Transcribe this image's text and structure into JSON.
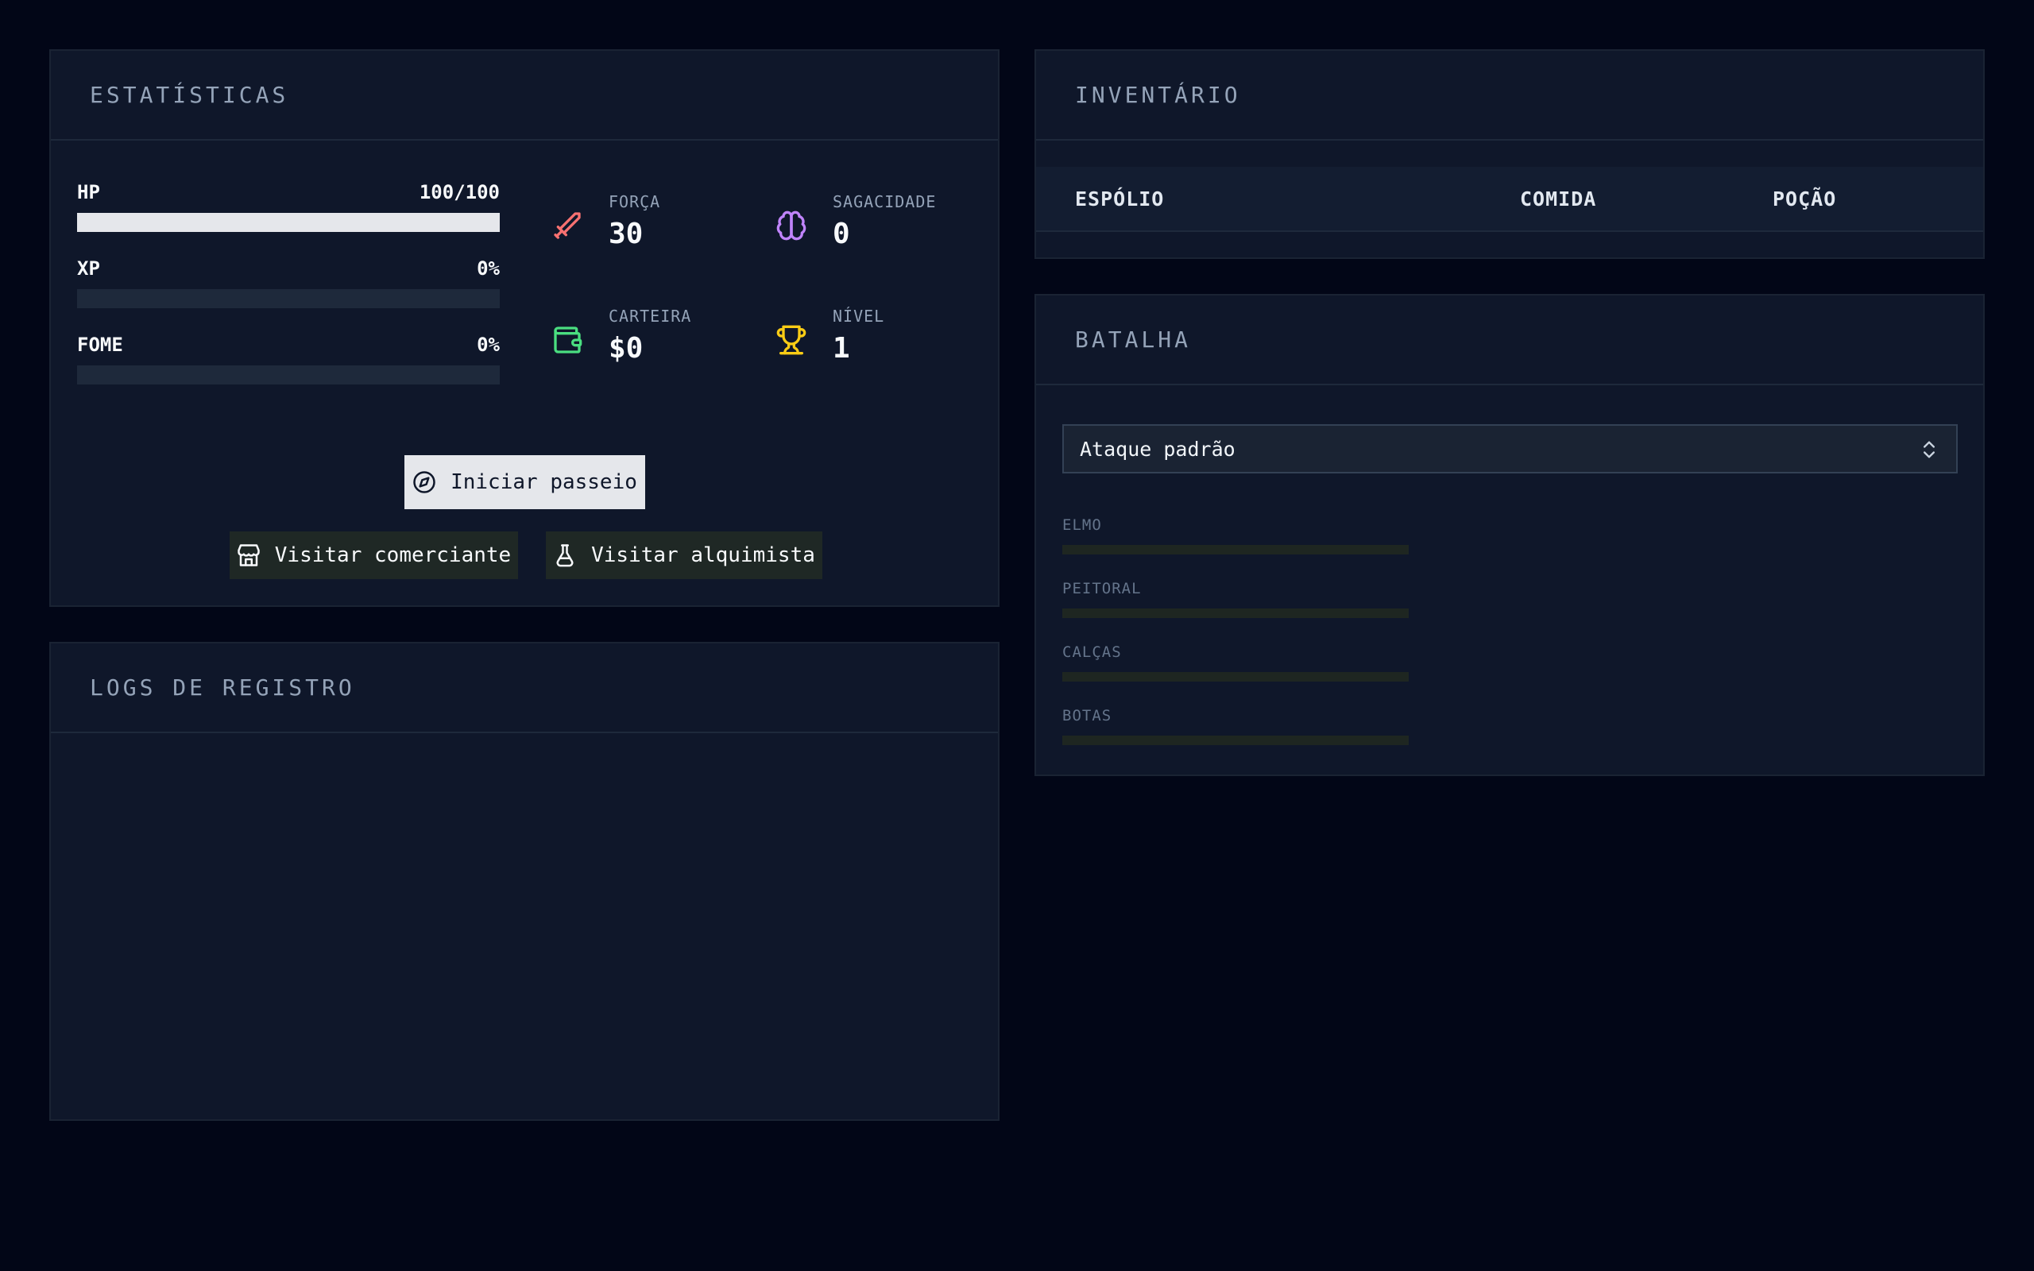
{
  "stats": {
    "title": "ESTATÍSTICAS",
    "bars": [
      {
        "label": "HP",
        "value_text": "100/100",
        "fill": 1.0
      },
      {
        "label": "XP",
        "value_text": "0%",
        "fill": 0.0
      },
      {
        "label": "FOME",
        "value_text": "0%",
        "fill": 0.0
      }
    ],
    "attributes": [
      {
        "label": "FORÇA",
        "value": "30",
        "icon": "sword-icon",
        "color": "#f87171"
      },
      {
        "label": "SAGACIDADE",
        "value": "0",
        "icon": "brain-icon",
        "color": "#c084fc"
      },
      {
        "label": "CARTEIRA",
        "value": "$0",
        "icon": "wallet-icon",
        "color": "#4ade80"
      },
      {
        "label": "NÍVEL",
        "value": "1",
        "icon": "trophy-icon",
        "color": "#facc15"
      }
    ],
    "actions": {
      "start_walk": "Iniciar passeio",
      "visit_merchant": "Visitar comerciante",
      "visit_alchemist": "Visitar alquimista"
    }
  },
  "logs": {
    "title": "LOGS DE REGISTRO"
  },
  "inventory": {
    "title": "INVENTÁRIO",
    "columns": [
      "ESPÓLIO",
      "COMIDA",
      "POÇÃO"
    ]
  },
  "battle": {
    "title": "BATALHA",
    "attack_select": "Ataque padrão",
    "armor": [
      {
        "label": "ELMO",
        "fill": 0.0
      },
      {
        "label": "PEITORAL",
        "fill": 0.0
      },
      {
        "label": "CALÇAS",
        "fill": 0.0
      },
      {
        "label": "BOTAS",
        "fill": 0.0
      }
    ]
  }
}
